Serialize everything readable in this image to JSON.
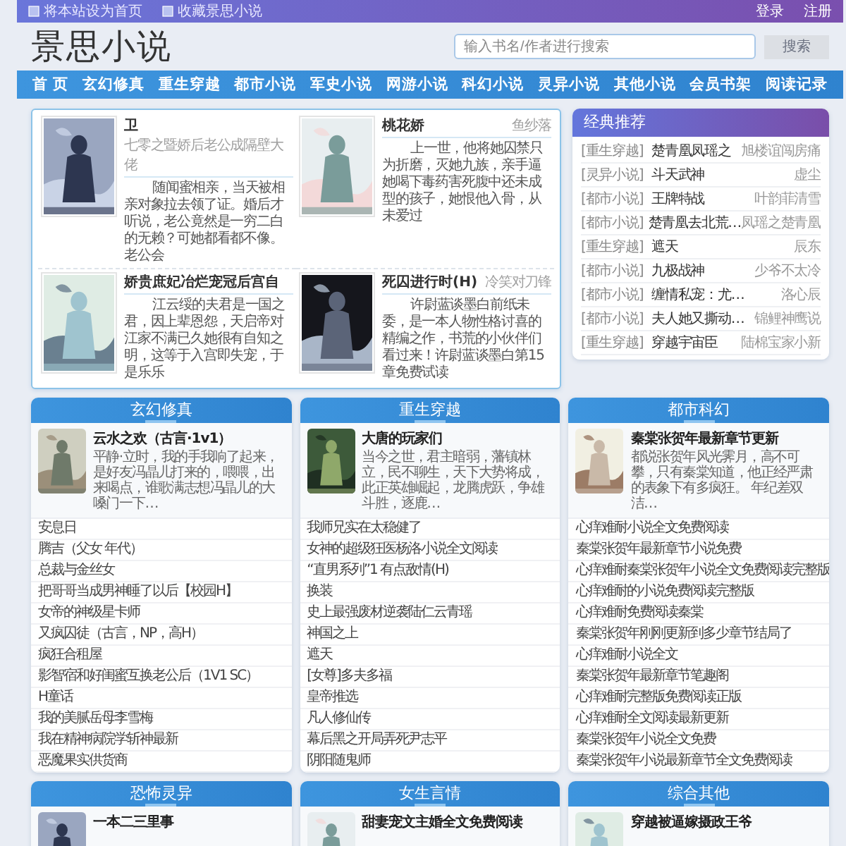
{
  "top_bar": {
    "links": [
      {
        "label": "将本站设为首页"
      },
      {
        "label": "收藏景思小说"
      }
    ],
    "account": [
      "登录",
      "注册"
    ]
  },
  "header": {
    "logo": "景思小说",
    "search": {
      "placeholder": "输入书名/作者进行搜索"
    },
    "search_button": "搜索"
  },
  "nav": [
    "首 页",
    "玄幻修真",
    "重生穿越",
    "都市小说",
    "军史小说",
    "网游小说",
    "科幻小说",
    "灵异小说",
    "其他小说",
    "会员书架",
    "阅读记录"
  ],
  "featured": [
    {
      "title": "卫",
      "author": "七零之暨娇后老公成隔壁大佬",
      "description": "随闻蜜相亲，当天被相亲对象拉去领了证。婚后才听说，老公竟然是一穷二白的无赖？可她都看都不像。老公会"
    },
    {
      "title": "桃花娇",
      "author": "鱼纱落",
      "description": "上一世，他将她囚禁只为折磨，灭她九族，亲手逼她喝下毒药害死腹中还未成型的孩子，她恨他入骨，从未爱过"
    },
    {
      "title": "娇贵庶妃冶烂宠冠后宫自",
      "description": "江云绥的夫君是一国之君，因上辈恩怨，天启帝对江家不满已久她很有自知之明，这等于入宫即失宠，于是乐乐"
    },
    {
      "title": "死囚进行时(H)",
      "author": "冷笑对刀锋",
      "description": "许尉蓝谈墨白前纸未委，是一本人物性格讨喜的精编之作，书荒的小伙伴们看过来！许尉蓝谈墨白第15章免费试读"
    }
  ],
  "sidebar": {
    "title": "经典推荐",
    "items": [
      {
        "category": "[重生穿越]",
        "title": "楚青凰凤瑶之",
        "author": "旭楼谊闯房痛"
      },
      {
        "category": "[灵异小说]",
        "title": "斗天武神",
        "author": "虚尘"
      },
      {
        "category": "[都市小说]",
        "title": "王牌特战",
        "author": "叶韵菲清雪"
      },
      {
        "category": "[都市小说]",
        "title": "楚青凰去北荒…",
        "author": "凤瑶之楚青凰"
      },
      {
        "category": "[重生穿越]",
        "title": "遮天",
        "author": "辰东"
      },
      {
        "category": "[都市小说]",
        "title": "九极战神",
        "author": "少爷不太冷"
      },
      {
        "category": "[都市小说]",
        "title": "缠情私宠：尤…",
        "author": "洛心辰"
      },
      {
        "category": "[都市小说]",
        "title": "夫人她又撕动…",
        "author": "锦鲤神鹰说"
      },
      {
        "category": "[重生穿越]",
        "title": "穿越宇宙臣",
        "author": "陆棉宝家小新"
      }
    ]
  },
  "sections": [
    {
      "title": "玄幻修真",
      "featured": {
        "title": "云水之欢（古言·1v1）",
        "description": "平静·立时，我的手我响了起来，是好友冯晶儿打来的，喂喂，出来喝点，谁歌满志想冯晶儿的大嗓门一下…"
      },
      "items": [
        "安息日",
        "腾吉（父女 年代）",
        "总裁与金丝女",
        "把哥哥当成男神睡了以后【校园H】",
        "女帝的神级星卡师",
        "又疯囚徒（古言，NP，高H）",
        "疯狂合租屋",
        "影智宿和好闺蜜互换老公后（1V1 SC）",
        "H童话",
        "我的美腻岳母李雪梅",
        "我在精神病院学斩神最新",
        "恶魔果实供货商"
      ]
    },
    {
      "title": "重生穿越",
      "featured": {
        "title": "大唐的玩家们",
        "description": "当今之世，君主暗弱，藩镇林立，民不聊生，天下大势将成，此正英雄崛起，龙腾虎跃，争雄斗胜，逐鹿…"
      },
      "items": [
        "我师兄实在太稳健了",
        "女神的超级狂医杨洛小说全文阅读",
        "“直男系列”1 有点敌情(H)",
        "换装",
        "史上最强废材逆袭陆仁云青瑶",
        "神国之上",
        "遮天",
        "[女尊]多夫多福",
        "皇帝推选",
        "凡人修仙传",
        "幕后黑之开局弄死尹志平",
        "阴阳随鬼师"
      ]
    },
    {
      "title": "都市科幻",
      "featured": {
        "title": "秦棠张贺年最新章节更新",
        "description": "都说张贺年风光霁月，高不可攀，只有秦棠知道，他正经严肃的表象下有多疯狂。 年纪差双洁…"
      },
      "items": [
        "心痒难耐小说全文免费阅读",
        "秦棠张贺年最新章节小说免费",
        "心痒难耐秦棠张贺年小说全文免费阅读完整版",
        "心痒难耐的小说免费阅读完整版",
        "心痒难耐免费阅读秦棠",
        "秦棠张贺年刚刚更新到多少章节结局了",
        "心痒难耐小说全文",
        "秦棠张贺年最新章节笔趣阁",
        "心痒难耐完整版免费阅读正版",
        "心痒难耐全文阅读最新更新",
        "秦棠张贺年小说全文免费",
        "秦棠张贺年小说最新章节全文免费阅读"
      ]
    },
    {
      "title": "恐怖灵异",
      "featured": {
        "title": "一本二三里事"
      }
    },
    {
      "title": "女生言情",
      "featured": {
        "title": "甜妻宠文主婚全文免费阅读"
      }
    },
    {
      "title": "综合其他",
      "featured": {
        "title": "穿越被逼嫁摄政王爷"
      }
    }
  ]
}
